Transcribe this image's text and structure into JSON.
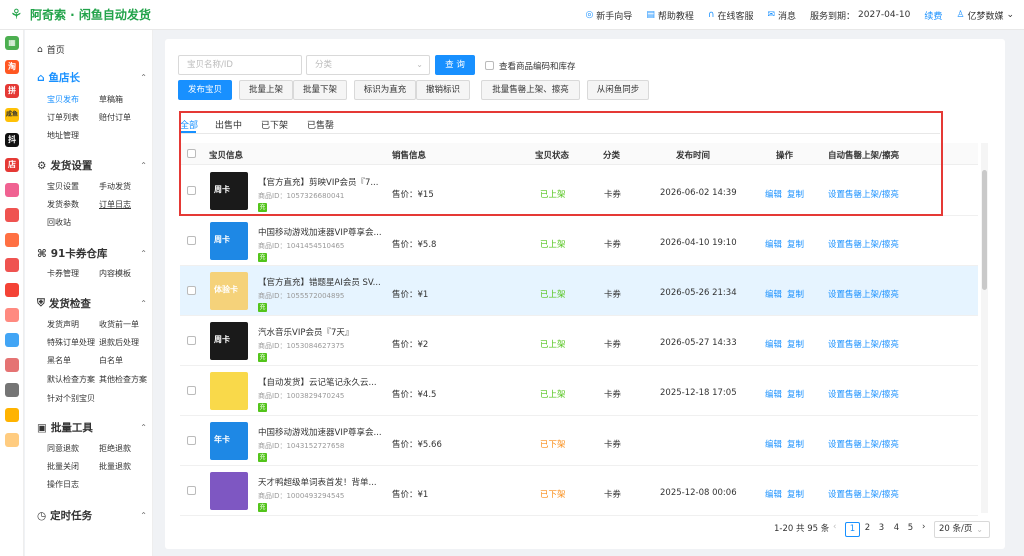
{
  "app": {
    "title": "阿奇索 · 闲鱼自动发货"
  },
  "topnav": {
    "guide": "新手向导",
    "help": "帮助教程",
    "service": "在线客服",
    "messages": "消息",
    "expiry_label": "服务到期：",
    "expiry_date": "2027-04-10",
    "renew": "续费",
    "user": "亿梦数媒"
  },
  "rail": [
    "淘",
    "拼",
    "咸鱼",
    "抖",
    "店",
    "",
    "",
    "",
    "",
    "",
    "",
    "",
    "",
    "",
    ""
  ],
  "sidebar": {
    "home": "首页",
    "groups": [
      {
        "title": "鱼店长",
        "items": [
          "宝贝发布",
          "草稿箱",
          "订单列表",
          "赔付订单",
          "地址管理"
        ]
      },
      {
        "title": "发货设置",
        "items": [
          "宝贝设置",
          "手动发货",
          "发货参数",
          "订单日志",
          "回收站"
        ]
      },
      {
        "title": "91卡券仓库",
        "items": [
          "卡券管理",
          "内容模板"
        ]
      },
      {
        "title": "发货检查",
        "items": [
          "发货声明",
          "收货前一单",
          "特殊订单处理",
          "退款后处理",
          "黑名单",
          "白名单",
          "默认检查方案",
          "其他检查方案",
          "针对个别宝贝"
        ]
      },
      {
        "title": "批量工具",
        "items": [
          "同意退款",
          "拒绝退款",
          "批量关闭",
          "批量退款",
          "操作日志"
        ]
      },
      {
        "title": "定时任务",
        "items": []
      }
    ]
  },
  "filters": {
    "name_placeholder": "宝贝名称/ID",
    "category_placeholder": "分类",
    "search": "查 询",
    "show_code_stock": "查看商品编码和库存"
  },
  "toolbar": [
    "发布宝贝",
    "批量上架",
    "批量下架",
    "标识为直充",
    "撤销标识",
    "批量售罄上架、擦亮",
    "从闲鱼同步"
  ],
  "tabs": [
    "全部",
    "出售中",
    "已下架",
    "已售罄"
  ],
  "columns": [
    "宝贝信息",
    "销售信息",
    "宝贝状态",
    "分类",
    "发布时间",
    "操作",
    "自动售罄上架/擦亮"
  ],
  "rows": [
    {
      "name": "【官方直充】剪映VIP会员『7...",
      "id_label": "商品ID：",
      "id": "1057326680041",
      "price_label": "售价：",
      "price": "¥15",
      "status": "已上架",
      "category": "卡券",
      "time": "2026-06-02 14:39",
      "edit": "编辑",
      "copy": "复制",
      "auto": "设置售罄上架/擦亮",
      "thumb_text": "周卡",
      "thumb_color": "#1a1a1a"
    },
    {
      "name": "中国移动游戏加速器VIP尊享会...",
      "id_label": "商品ID：",
      "id": "1041454510465",
      "price_label": "售价：",
      "price": "¥5.8",
      "status": "已上架",
      "category": "卡券",
      "time": "2026-04-10 19:10",
      "edit": "编辑",
      "copy": "复制",
      "auto": "设置售罄上架/擦亮",
      "thumb_text": "周卡",
      "thumb_color": "#1e88e5"
    },
    {
      "name": "【官方直充】错题星AI会员 SV...",
      "id_label": "商品ID：",
      "id": "1055572004895",
      "price_label": "售价：",
      "price": "¥1",
      "status": "已上架",
      "category": "卡券",
      "time": "2026-05-26 21:34",
      "edit": "编辑",
      "copy": "复制",
      "auto": "设置售罄上架/擦亮",
      "thumb_text": "体验卡",
      "thumb_color": "#f5d27a"
    },
    {
      "name": "汽水音乐VIP会员『7天』",
      "id_label": "商品ID：",
      "id": "1053084627375",
      "price_label": "售价：",
      "price": "¥2",
      "status": "已上架",
      "category": "卡券",
      "time": "2026-05-27 14:33",
      "edit": "编辑",
      "copy": "复制",
      "auto": "设置售罄上架/擦亮",
      "thumb_text": "周卡",
      "thumb_color": "#1a1a1a"
    },
    {
      "name": "【自动发货】云记笔记永久云...",
      "id_label": "商品ID：",
      "id": "1003829470245",
      "price_label": "售价：",
      "price": "¥4.5",
      "status": "已上架",
      "category": "卡券",
      "time": "2025-12-18 17:05",
      "edit": "编辑",
      "copy": "复制",
      "auto": "设置售罄上架/擦亮",
      "thumb_text": "",
      "thumb_color": "#f9d94a"
    },
    {
      "name": "中国移动游戏加速器VIP尊享会...",
      "id_label": "商品ID：",
      "id": "1043152727658",
      "price_label": "售价：",
      "price": "¥5.66",
      "status": "已下架",
      "category": "卡券",
      "time": "",
      "edit": "编辑",
      "copy": "复制",
      "auto": "设置售罄上架/擦亮",
      "thumb_text": "年卡",
      "thumb_color": "#1e88e5"
    },
    {
      "name": "天才鸭超级单词表首发！背单...",
      "id_label": "商品ID：",
      "id": "1000493294545",
      "price_label": "售价：",
      "price": "¥1",
      "status": "已下架",
      "category": "卡券",
      "time": "2025-12-08 00:06",
      "edit": "编辑",
      "copy": "复制",
      "auto": "设置售罄上架/擦亮",
      "thumb_text": "",
      "thumb_color": "#7e57c2"
    }
  ],
  "pagination": {
    "summary": "1-20 共 95 条",
    "pages": [
      "1",
      "2",
      "3",
      "4",
      "5"
    ],
    "per_page": "20 条/页"
  }
}
